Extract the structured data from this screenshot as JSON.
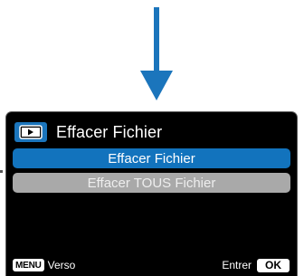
{
  "indicator": {
    "color": "#1b75bc"
  },
  "header": {
    "icon": "play-icon",
    "title": "Effacer Fichier"
  },
  "menu": {
    "items": [
      {
        "label": "Effacer Fichier",
        "selected": true
      },
      {
        "label": "Effacer TOUS Fichier",
        "selected": false
      }
    ]
  },
  "footer": {
    "left_key": "MENU",
    "left_label": "Verso",
    "right_label": "Entrer",
    "right_key": "OK"
  },
  "colors": {
    "accent": "#1273bd",
    "unselected": "#a9a9a9",
    "background": "#000000"
  }
}
